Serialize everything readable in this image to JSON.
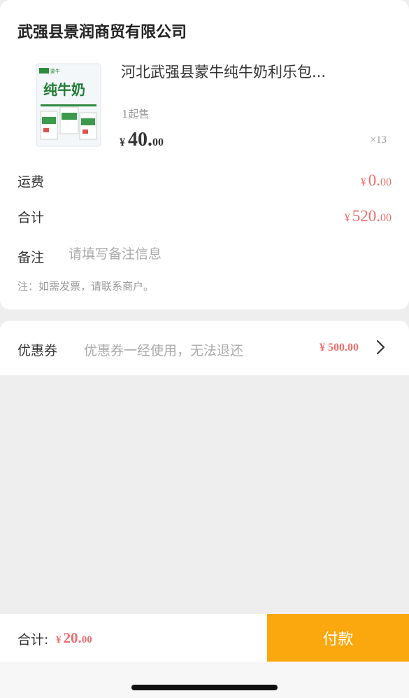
{
  "order": {
    "shop_name": "武强县景润商贸有限公司",
    "product": {
      "title": "河北武强县蒙牛纯牛奶利乐包...",
      "min_sale": "1起售",
      "price_currency": "¥",
      "price_int": "40.",
      "price_dec": "00",
      "quantity": "×13",
      "image_text": "纯牛奶",
      "image_brand": "蒙牛"
    },
    "shipping": {
      "label": "运费",
      "currency": "¥",
      "int": "0.",
      "dec": "00"
    },
    "subtotal": {
      "label": "合计",
      "currency": "¥",
      "int": "520.",
      "dec": "00"
    },
    "remark": {
      "label": "备注",
      "placeholder": "请填写备注信息",
      "value": ""
    },
    "note": "注：如需发票，请联系商户。"
  },
  "coupon": {
    "label": "优惠券",
    "description": "优惠券一经使用，无法退还",
    "amount": "¥ 500.00",
    "chevron_icon": "chevron-right-icon"
  },
  "footer": {
    "total_label": "合计:",
    "total_currency": "¥",
    "total_int": "20.",
    "total_dec": "00",
    "pay_label": "付款"
  },
  "colors": {
    "accent": "#fba70e",
    "price_red": "#ef6e6e",
    "background": "#eeeeee"
  }
}
